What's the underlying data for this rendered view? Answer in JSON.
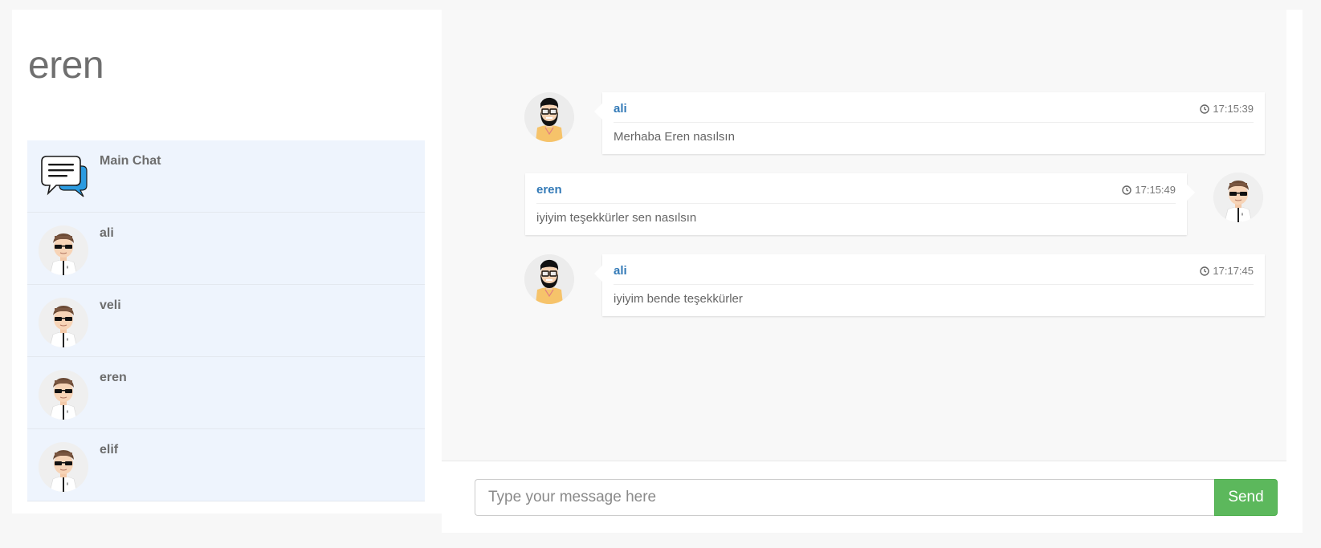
{
  "user": {
    "name": "eren"
  },
  "contacts": [
    {
      "name": "Main Chat",
      "icon": "chat-bubbles-icon"
    },
    {
      "name": "ali",
      "icon": "user-avatar-icon"
    },
    {
      "name": "veli",
      "icon": "user-avatar-icon"
    },
    {
      "name": "eren",
      "icon": "user-avatar-icon"
    },
    {
      "name": "elif",
      "icon": "user-avatar-icon"
    }
  ],
  "messages": [
    {
      "sender": "ali",
      "time": "17:15:39",
      "text": "Merhaba Eren nasılsın",
      "side": "left",
      "avatar": "bearded-man-avatar-icon"
    },
    {
      "sender": "eren",
      "time": "17:15:49",
      "text": "iyiyim teşekkürler sen nasılsın",
      "side": "right",
      "avatar": "user-avatar-icon"
    },
    {
      "sender": "ali",
      "time": "17:17:45",
      "text": "iyiyim bende teşekkürler",
      "side": "left",
      "avatar": "bearded-man-avatar-icon"
    }
  ],
  "composer": {
    "placeholder": "Type your message here",
    "send_label": "Send"
  },
  "colors": {
    "accent_link": "#337ab7",
    "send_button": "#5cb85c",
    "contact_bg": "#eef4fd",
    "chat_bg": "#f8f8f8"
  }
}
